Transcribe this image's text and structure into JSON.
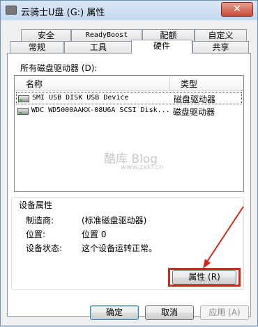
{
  "window": {
    "title": "云骑士U盘 (G:) 属性",
    "close_label": "✕"
  },
  "tabs_row1": [
    "安全",
    "ReadyBoost",
    "配额",
    "自定义"
  ],
  "tabs_row2": [
    "常规",
    "工具",
    "硬件",
    "共享"
  ],
  "active_tab": "硬件",
  "hardware": {
    "list_label": "所有磁盘驱动器 (D):",
    "col_name": "名称",
    "col_type": "类型",
    "rows": [
      {
        "name": "SMI USB DISK USB Device",
        "type": "磁盘驱动器",
        "selected": true
      },
      {
        "name": "WDC WD5000AAKX-08U6A SCSI Disk...",
        "type": "磁盘驱动器",
        "selected": false
      }
    ],
    "watermark": "酷库 Blog",
    "watermark_url": "www.zxki.cn"
  },
  "device_props": {
    "title": "设备属性",
    "manufacturer_label": "制造商:",
    "manufacturer_value": "(标准磁盘驱动器)",
    "location_label": "位置:",
    "location_value": "位置 0",
    "status_label": "设备状态:",
    "status_value": "这个设备运转正常。",
    "properties_button": "属性 (R)"
  },
  "footer": {
    "ok": "确定",
    "cancel": "取消",
    "apply": "应用 (A)"
  },
  "colors": {
    "highlight": "#d9231b"
  }
}
